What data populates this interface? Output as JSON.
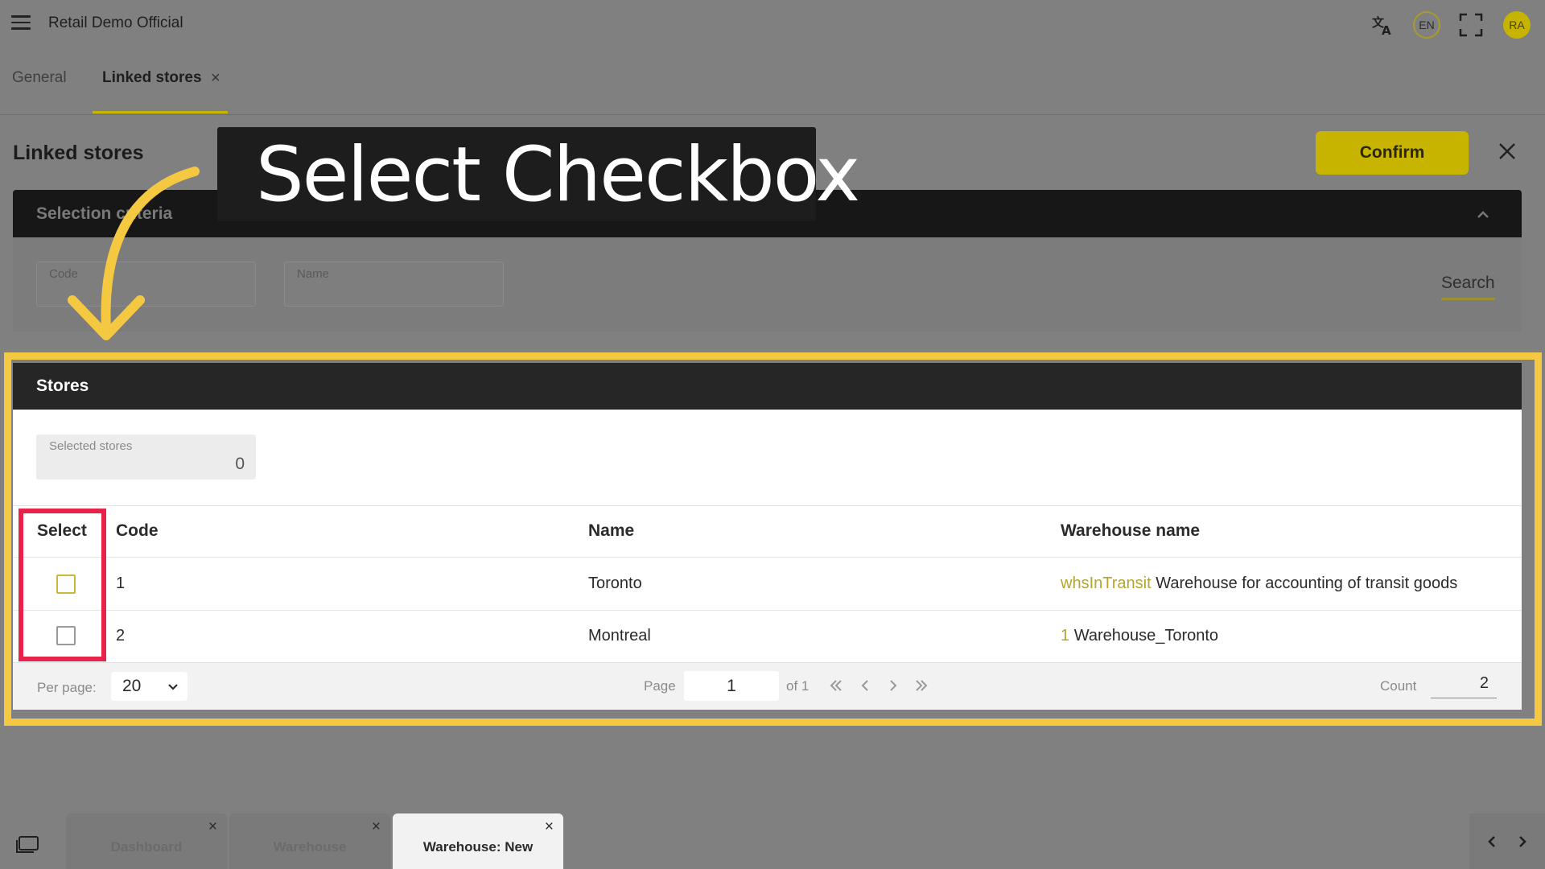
{
  "app": {
    "title": "Retail Demo Official",
    "lang": "EN",
    "user_initials": "RA"
  },
  "tabs": [
    {
      "label": "General"
    },
    {
      "label": "Linked stores",
      "close": "×"
    }
  ],
  "header": {
    "title": "Linked stores",
    "confirm_label": "Confirm"
  },
  "criteria": {
    "title": "Selection criteria",
    "code_label": "Code",
    "name_label": "Name",
    "search_label": "Search"
  },
  "overlay": {
    "text": "Select Checkbox"
  },
  "stores": {
    "title": "Stores",
    "selected_label": "Selected stores",
    "selected_value": "0",
    "columns": {
      "select": "Select",
      "code": "Code",
      "name": "Name",
      "warehouse": "Warehouse name"
    },
    "rows": [
      {
        "code": "1",
        "name": "Toronto",
        "wh_code": "whsInTransit",
        "wh_name": "Warehouse for accounting of transit goods"
      },
      {
        "code": "2",
        "name": "Montreal",
        "wh_code": "1",
        "wh_name": "Warehouse_Toronto"
      }
    ]
  },
  "pagination": {
    "per_page_label": "Per page:",
    "per_page_value": "20",
    "page_label": "Page",
    "page_value": "1",
    "of_label": "of 1",
    "count_label": "Count",
    "count_value": "2"
  },
  "taskbar": {
    "tabs": [
      {
        "label": "Dashboard",
        "close": "×"
      },
      {
        "label": "Warehouse",
        "close": "×"
      },
      {
        "label": "Warehouse: New",
        "close": "×"
      }
    ]
  },
  "colors": {
    "accent": "#c7b400",
    "highlight_yellow": "#f5c842",
    "highlight_red": "#e8234a"
  }
}
